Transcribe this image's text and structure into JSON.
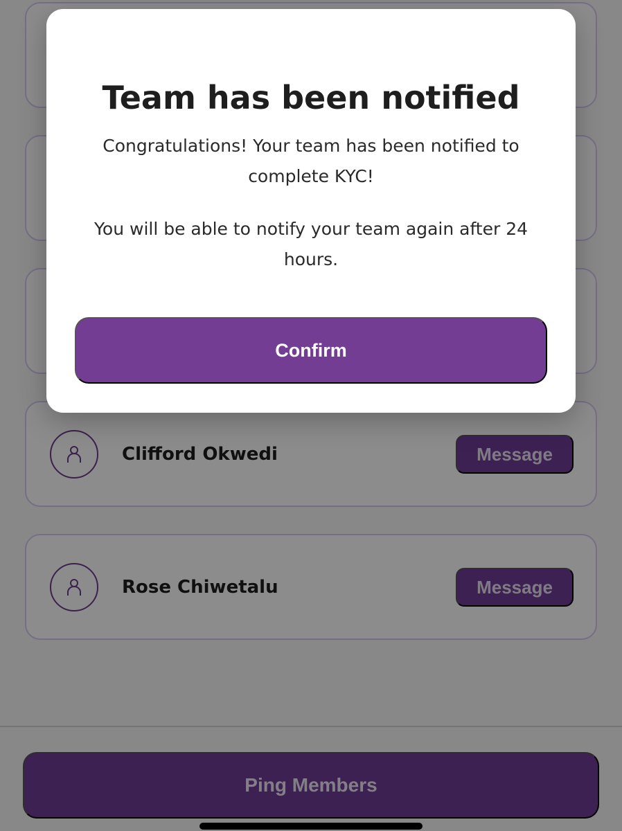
{
  "members": [
    {
      "name": "",
      "message_label": ""
    },
    {
      "name": "",
      "message_label": ""
    },
    {
      "name": "",
      "message_label": ""
    },
    {
      "name": "Clifford Okwedi",
      "message_label": "Message"
    },
    {
      "name": "Rose Chiwetalu",
      "message_label": "Message"
    }
  ],
  "footer": {
    "ping_label": "Ping Members"
  },
  "modal": {
    "title": "Team has been notified",
    "message_1": "Congratulations! Your team has been notified to complete KYC!",
    "message_2": "You will be able to notify your team again after 24 hours.",
    "confirm_label": "Confirm"
  },
  "icons": {
    "avatar": "user-icon"
  },
  "colors": {
    "accent": "#733d93",
    "card_border": "#d9c9ef",
    "overlay": "rgba(0,0,0,0.45)"
  }
}
